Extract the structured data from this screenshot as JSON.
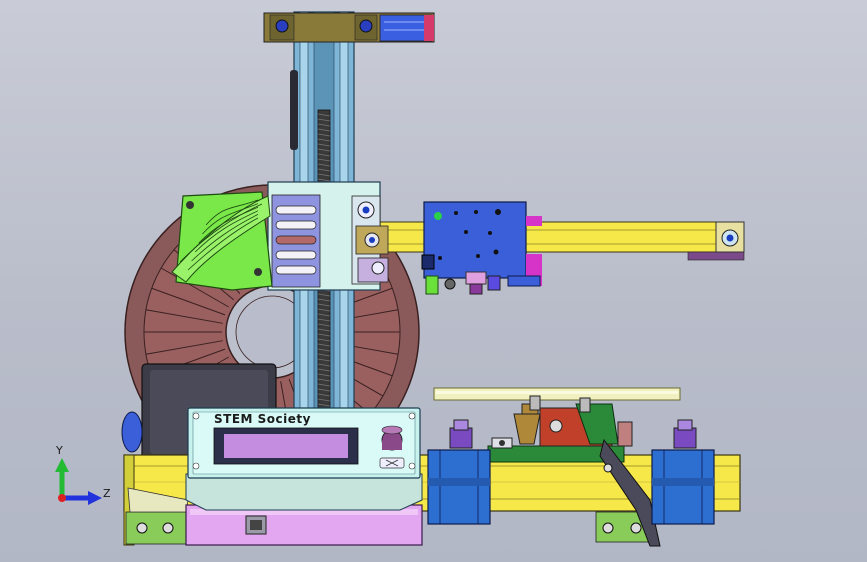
{
  "view": {
    "background_top": "#c9ccd6",
    "background_bottom": "#b2b7c6"
  },
  "triad": {
    "y_label": "Y",
    "z_label": "Z",
    "y_color": "#22bb33",
    "z_color": "#2233dd",
    "x_color": "#dd2222"
  },
  "lcd_panel": {
    "brand_text": "STEM Society",
    "panel_color": "#c7f2ee",
    "screen_color": "#c58de0"
  },
  "parts": {
    "frame_color": "#f7e84a",
    "extrusion_color": "#7fb5d6",
    "spool_color": "#8a5a5a",
    "fan_shroud_color": "#7be84a",
    "hotend_carriage_color": "#3b5fd9",
    "stepper_color": "#2c6fd1",
    "base_box_color": "#e3a6f0",
    "accent_magenta": "#d633c8"
  }
}
